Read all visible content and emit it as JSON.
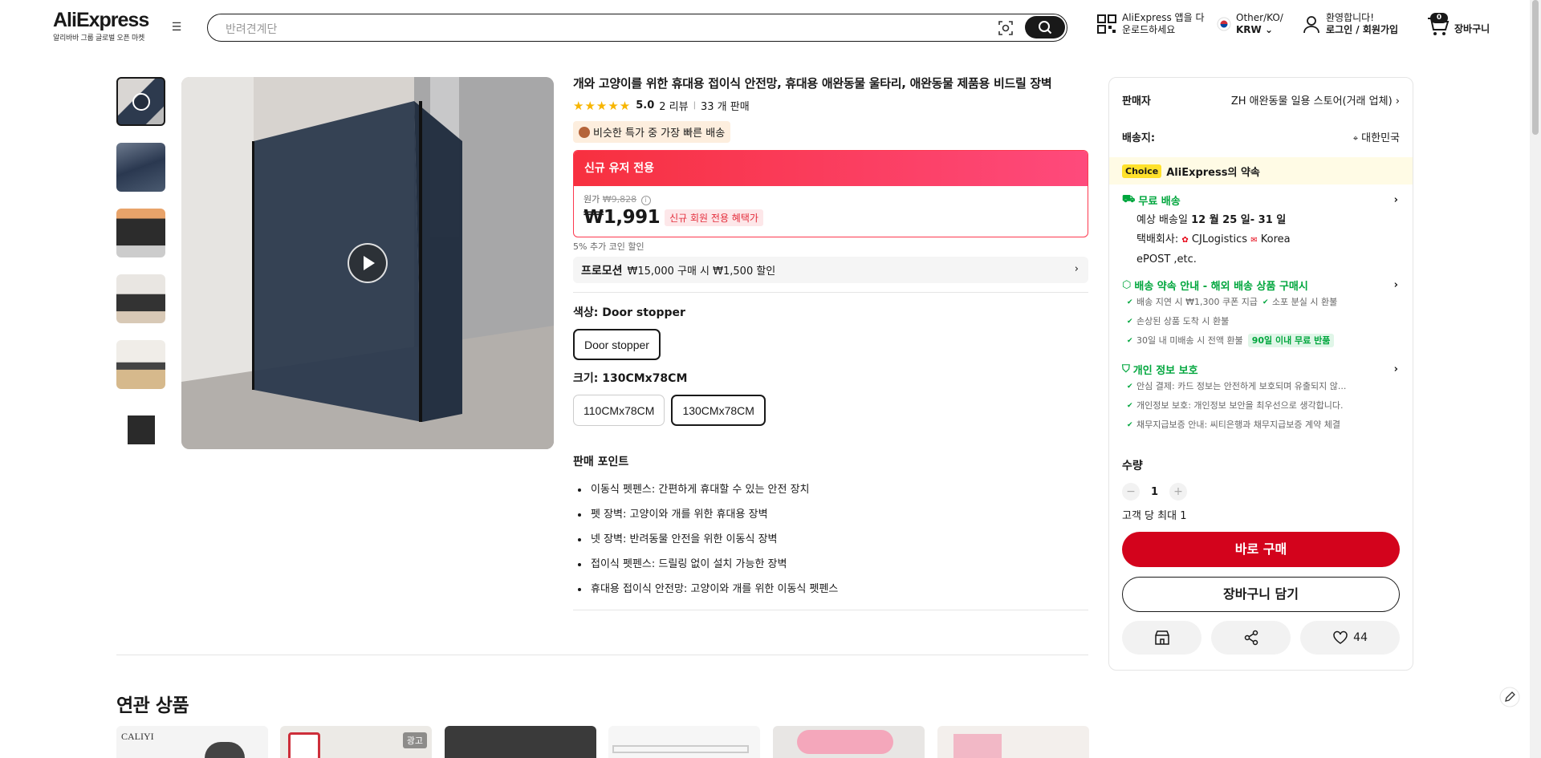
{
  "header": {
    "logo": "AliExpress",
    "logo_sub": "알리바바 그룹 글로벌 오픈 마켓",
    "search_placeholder": "반려견계단",
    "app_line1": "AliExpress 앱을 다",
    "app_line2": "운로드하세요",
    "region_line1": "Other/KO/",
    "region_line2": "KRW",
    "welcome": "환영합니다!",
    "login": "로그인 / 회원가입",
    "cart_count": "0",
    "cart_label": "장바구니"
  },
  "product": {
    "title": "개와 고양이를 위한 휴대용 접이식 안전망, 휴대용 애완동물 울타리, 애완동물 제품용 비드릴 장벽",
    "stars": "★★★★★",
    "score": "5.0",
    "reviews": "2 리뷰",
    "sold": "33 개 판매",
    "fast_badge": "비슷한 특가 중 가장 빠른 배송",
    "promo_header": "신규 유저 전용",
    "orig_label": "원가",
    "orig_price": "₩9,828",
    "price": "₩1,991",
    "new_member_badge": "신규 회원 전용 혜택가",
    "coin_note": "5% 추가 코인 할인",
    "promotion_label": "프로모션",
    "promotion_text": "₩15,000 구매 시 ₩1,500 할인",
    "color_label": "색상: Door stopper",
    "colors": [
      "Door stopper"
    ],
    "size_label": "크기: 130CMx78CM",
    "sizes": [
      "110CMx78CM",
      "130CMx78CM"
    ],
    "points_title": "판매 포인트",
    "points": [
      "이동식 펫펜스: 간편하게 휴대할 수 있는 안전 장치",
      "펫 장벽: 고양이와 개를 위한 휴대용 장벽",
      "넷 장벽: 반려동물 안전을 위한 이동식 장벽",
      "접이식 펫펜스: 드릴링 없이 설치 가능한 장벽",
      "휴대용 접이식 안전망: 고양이와 개를 위한 이동식 펫펜스"
    ]
  },
  "side": {
    "seller_label": "판매자",
    "seller_name": "ZH 애완동물 일용 스토어(거래 업체)",
    "ship_to_label": "배송지:",
    "ship_to": "대한민국",
    "choice_tag": "Choice",
    "choice_text": "AliExpress의 약속",
    "free_ship": "무료 배송",
    "eta_prefix": "예상 배송일",
    "eta": "12 월 25 일- 31 일",
    "carrier_label": "택배회사:",
    "carrier1": "CJLogistics",
    "carrier2": "Korea",
    "carrier3": "ePOST ,etc.",
    "promise_title": "배송 약속 안내 - 해외 배송 상품 구매시",
    "promise_items": [
      "배송 지연 시 ₩1,300 쿠폰 지급",
      "소포 분실 시 환불",
      "손상된 상품 도착 시 환불",
      "30일 내 미배송 시 전액 환불"
    ],
    "return_badge": "90일 이내 무료 반품",
    "privacy_title": "개인 정보 보호",
    "privacy_items": [
      "안심 결제: 카드 정보는 안전하게 보호되며 유출되지 않...",
      "개인정보 보호: 개인정보 보안을 최우선으로 생각합니다.",
      "채무지급보증 안내: 씨티은행과 채무지급보증 계약 체결"
    ],
    "qty_label": "수량",
    "qty_value": "1",
    "qty_limit": "고객 당 최대 1",
    "buy_now": "바로 구매",
    "add_cart": "장바구니 담기",
    "wish_count": "44"
  },
  "related": {
    "title": "연관 상품",
    "ad_label": "광고",
    "brand": "CALIYI"
  }
}
